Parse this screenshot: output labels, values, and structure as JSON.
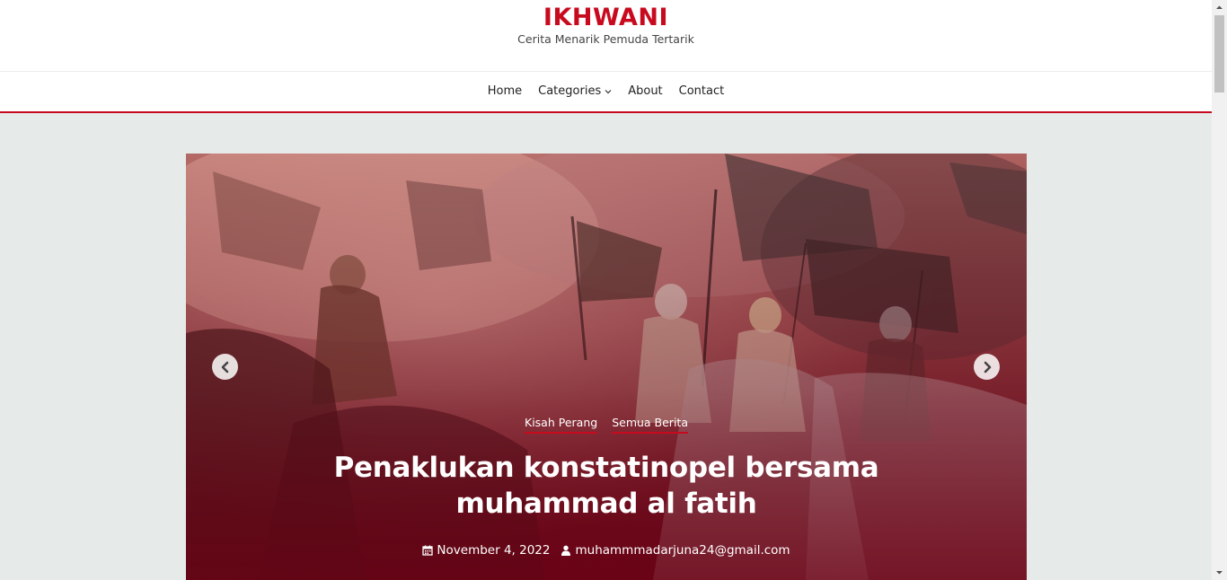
{
  "header": {
    "site_title": "IKHWANI",
    "tagline": "Cerita Menarik Pemuda Tertarik"
  },
  "nav": {
    "items": [
      {
        "label": "Home"
      },
      {
        "label": "Categories"
      },
      {
        "label": "About"
      },
      {
        "label": "Contact"
      }
    ]
  },
  "slider": {
    "categories": [
      "Kisah Perang",
      "Semua Berita"
    ],
    "title": "Penaklukan konstatinopel bersama muhammad al fatih",
    "date": "November 4, 2022",
    "author": "muhammmadarjuna24@gmail.com",
    "icons": {
      "prev": "chevron-left-circle-icon",
      "next": "chevron-right-circle-icon",
      "date": "calendar-icon",
      "author": "user-icon"
    }
  },
  "colors": {
    "accent": "#c80a1e",
    "background": "#e6ebea"
  }
}
